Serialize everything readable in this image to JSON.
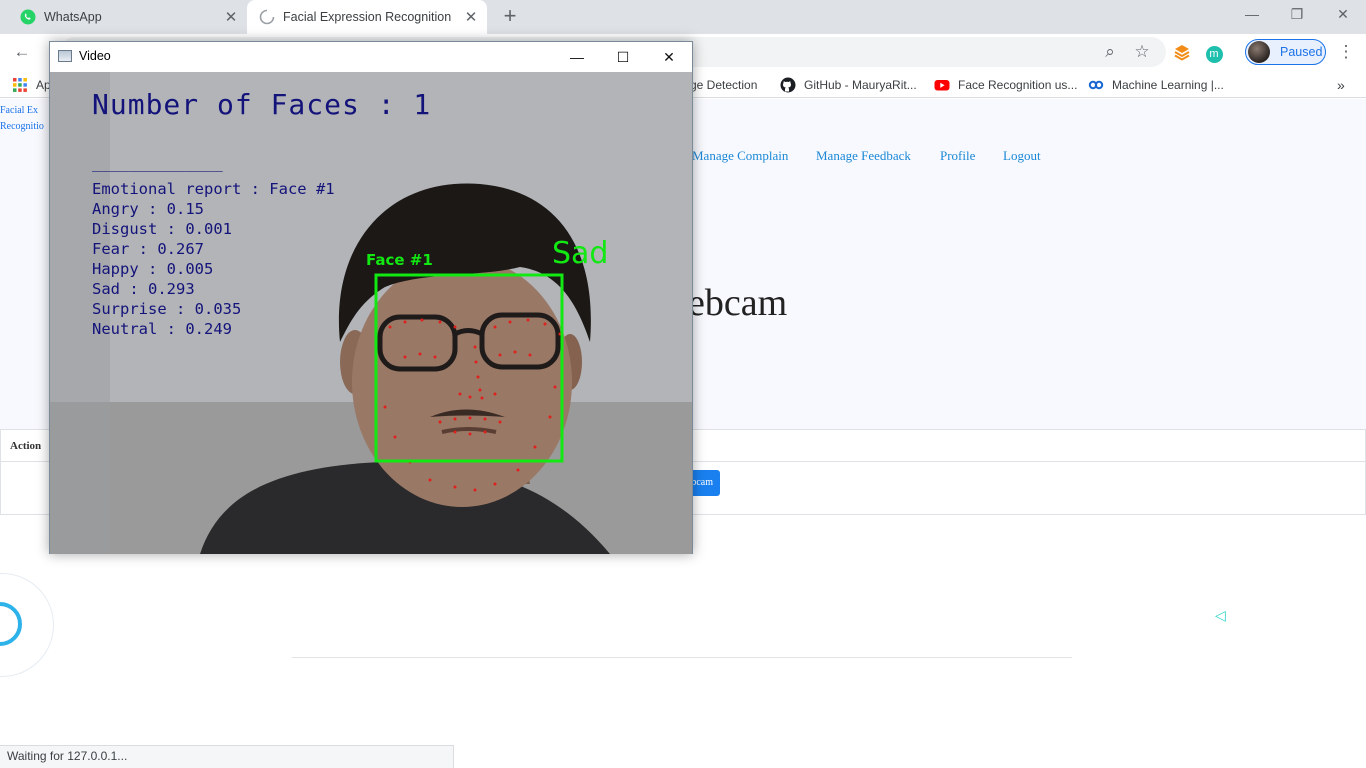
{
  "browser": {
    "tabs": [
      {
        "title": "WhatsApp",
        "icon": "whatsapp-icon",
        "active": false
      },
      {
        "title": "Facial Expression Recognition",
        "icon": "loading-spinner-icon",
        "active": true
      }
    ],
    "profile_status": "Paused",
    "profile_initial": "m",
    "bookmarks": [
      {
        "label": "Ap",
        "icon": "apps-grid-icon"
      },
      {
        "label": "ge Detection",
        "icon": ""
      },
      {
        "label": "GitHub - MauryaRit...",
        "icon": "github-icon"
      },
      {
        "label": "Face Recognition us...",
        "icon": "youtube-icon"
      },
      {
        "label": "Machine Learning |...",
        "icon": "link-icon"
      }
    ],
    "status_text": "Waiting for 127.0.0.1..."
  },
  "page": {
    "broken_image_alt": "Facial Ex Recognitio",
    "nav": [
      "Manage Complain",
      "Manage Feedback",
      "Profile",
      "Logout"
    ],
    "heading_fragment": "ebcam",
    "table_header": "Action",
    "webcam_button_fragment": "bcam"
  },
  "video_window": {
    "title": "Video",
    "faces_count_text": "Number of Faces : 1",
    "separator": "______________",
    "report_title": "Emotional report : Face #1",
    "emotions": [
      {
        "label": "Angry : 0.15"
      },
      {
        "label": "Disgust : 0.001"
      },
      {
        "label": "Fear : 0.267"
      },
      {
        "label": "Happy : 0.005"
      },
      {
        "label": "Sad : 0.293"
      },
      {
        "label": "Surprise : 0.035"
      },
      {
        "label": "Neutral : 0.249"
      }
    ],
    "face_label": "Face #1",
    "predicted_emotion": "Sad",
    "box_color": "#12e812",
    "text_color": "#14137a"
  }
}
